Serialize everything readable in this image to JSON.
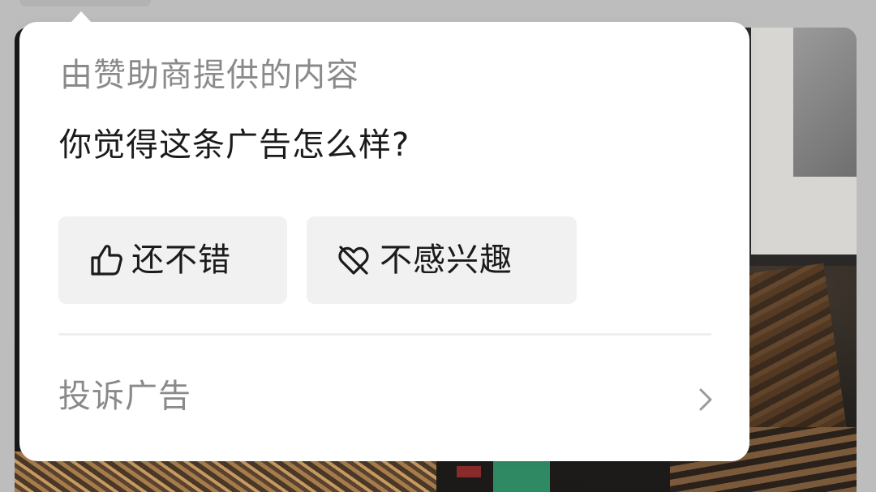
{
  "popup": {
    "sponsor_label": "由赞助商提供的内容",
    "question": "你觉得这条广告怎么样?",
    "buttons": [
      {
        "label": "还不错",
        "icon": "thumbs-up-icon"
      },
      {
        "label": "不感兴趣",
        "icon": "heart-slash-icon"
      }
    ],
    "report": {
      "label": "投诉广告",
      "icon": "chevron-right-icon"
    }
  },
  "colors": {
    "overlay": "#bdbdbd",
    "popup_bg": "#ffffff",
    "button_bg": "#f1f1f1",
    "primary_text": "#1b1b1b",
    "secondary_text": "#8a8a8a",
    "divider": "#efefef"
  }
}
